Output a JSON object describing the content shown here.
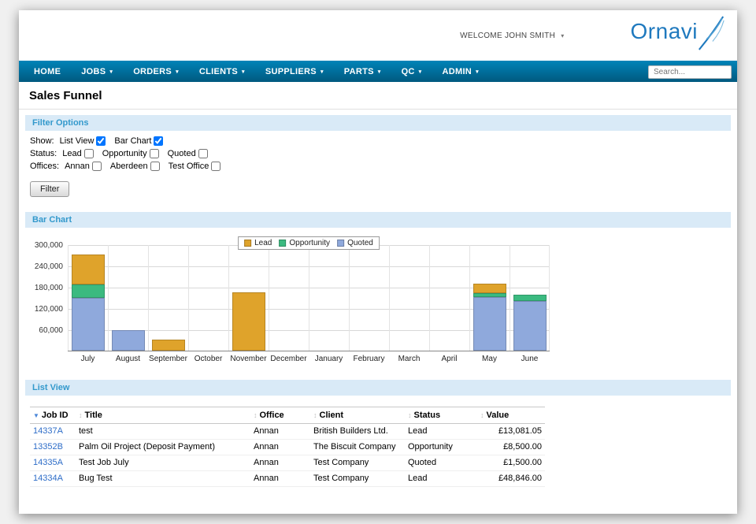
{
  "colors": {
    "nav_bg_top": "#0084B8",
    "nav_bg_bottom": "#00597F",
    "section_bg": "#D9EAF7",
    "section_text": "#3399CC",
    "link": "#2E6DC8"
  },
  "header": {
    "welcome": "WELCOME JOHN SMITH",
    "brand": "Ornavi"
  },
  "nav": {
    "items": [
      {
        "label": "HOME",
        "dropdown": false
      },
      {
        "label": "JOBS",
        "dropdown": true
      },
      {
        "label": "ORDERS",
        "dropdown": true
      },
      {
        "label": "CLIENTS",
        "dropdown": true
      },
      {
        "label": "SUPPLIERS",
        "dropdown": true
      },
      {
        "label": "PARTS",
        "dropdown": true
      },
      {
        "label": "QC",
        "dropdown": true
      },
      {
        "label": "ADMIN",
        "dropdown": true
      }
    ],
    "search_placeholder": "Search..."
  },
  "page_title": "Sales Funnel",
  "filter": {
    "title": "Filter Options",
    "groups": [
      {
        "name": "show",
        "label": "Show:",
        "options": [
          {
            "label": "List View",
            "checked": true
          },
          {
            "label": "Bar Chart",
            "checked": true
          }
        ]
      },
      {
        "name": "status",
        "label": "Status:",
        "options": [
          {
            "label": "Lead",
            "checked": false
          },
          {
            "label": "Opportunity",
            "checked": false
          },
          {
            "label": "Quoted",
            "checked": false
          }
        ]
      },
      {
        "name": "offices",
        "label": "Offices:",
        "options": [
          {
            "label": "Annan",
            "checked": false
          },
          {
            "label": "Aberdeen",
            "checked": false
          },
          {
            "label": "Test Office",
            "checked": false
          }
        ]
      }
    ],
    "button_label": "Filter"
  },
  "chart_section_title": "Bar Chart",
  "chart_data": {
    "type": "bar",
    "stacked": true,
    "categories": [
      "July",
      "August",
      "September",
      "October",
      "November",
      "December",
      "January",
      "February",
      "March",
      "April",
      "May",
      "June"
    ],
    "series": [
      {
        "name": "Lead",
        "color": "#DFA32B",
        "values": [
          85000,
          0,
          32000,
          0,
          165000,
          0,
          0,
          0,
          0,
          0,
          28000,
          0
        ]
      },
      {
        "name": "Opportunity",
        "color": "#3BBA80",
        "values": [
          37000,
          0,
          0,
          0,
          0,
          0,
          0,
          0,
          0,
          0,
          10000,
          18000
        ]
      },
      {
        "name": "Quoted",
        "color": "#8FA9DC",
        "values": [
          150000,
          58000,
          0,
          0,
          0,
          0,
          0,
          0,
          0,
          0,
          152000,
          140000
        ]
      }
    ],
    "ylim": [
      0,
      300000
    ],
    "yticks": [
      {
        "value": 300000,
        "label": "300,000"
      },
      {
        "value": 240000,
        "label": "240,000"
      },
      {
        "value": 180000,
        "label": "180,000"
      },
      {
        "value": 120000,
        "label": "120,000"
      },
      {
        "value": 60000,
        "label": "60,000"
      }
    ],
    "legend_position": "top",
    "grid": true
  },
  "list": {
    "title": "List View",
    "columns": [
      {
        "label": "Job ID",
        "sorted": true
      },
      {
        "label": "Title",
        "sorted": false
      },
      {
        "label": "Office",
        "sorted": false
      },
      {
        "label": "Client",
        "sorted": false
      },
      {
        "label": "Status",
        "sorted": false
      },
      {
        "label": "Value",
        "sorted": false
      }
    ],
    "rows": [
      [
        "14337A",
        "test",
        "Annan",
        "British Builders Ltd.",
        "Lead",
        "£13,081.05"
      ],
      [
        "13352B",
        "Palm Oil Project (Deposit Payment)",
        "Annan",
        "The Biscuit Company",
        "Opportunity",
        "£8,500.00"
      ],
      [
        "14335A",
        "Test Job July",
        "Annan",
        "Test Company",
        "Quoted",
        "£1,500.00"
      ],
      [
        "14334A",
        "Bug Test",
        "Annan",
        "Test Company",
        "Lead",
        "£48,846.00"
      ]
    ]
  }
}
